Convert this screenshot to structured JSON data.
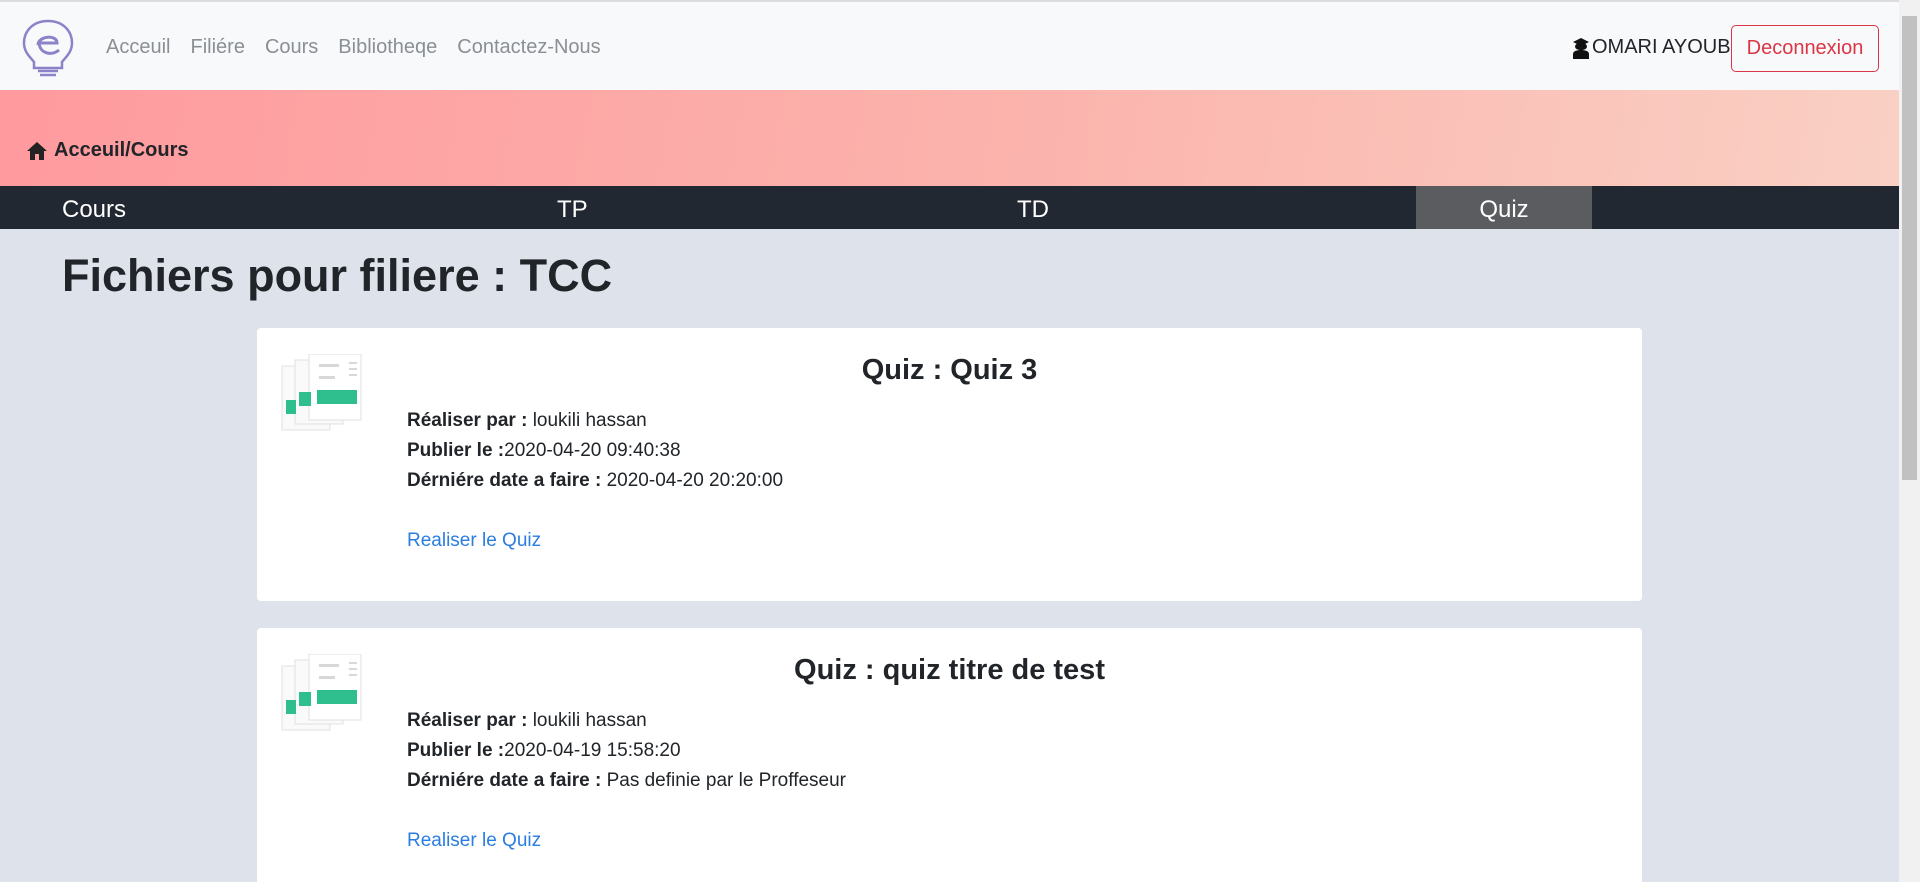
{
  "navbar": {
    "links": [
      "Acceuil",
      "Filiére",
      "Cours",
      "Bibliotheqe",
      "Contactez-Nous"
    ],
    "user_name": "OMARI AYOUB",
    "logout_label": "Deconnexion"
  },
  "banner": {
    "breadcrumb": "Acceuil/Cours"
  },
  "tabs": {
    "items": [
      "Cours",
      "TP",
      "TD",
      "Quiz"
    ],
    "active": "Quiz"
  },
  "main": {
    "title": "Fichiers pour filiere : TCC",
    "quizzes": [
      {
        "title": "Quiz : Quiz 3",
        "author_label": "Réaliser par :",
        "author": "loukili hassan",
        "published_label": "Publier le :",
        "published": "2020-04-20 09:40:38",
        "deadline_label": "Dérniére date a faire :",
        "deadline": "2020-04-20 20:20:00",
        "action_label": "Realiser le Quiz"
      },
      {
        "title": "Quiz : quiz titre de test",
        "author_label": "Réaliser par :",
        "author": "loukili hassan",
        "published_label": "Publier le :",
        "published": "2020-04-19 15:58:20",
        "deadline_label": "Dérniére date a faire :",
        "deadline": "Pas definie par le Proffeseur",
        "action_label": "Realiser le Quiz"
      }
    ]
  },
  "colors": {
    "accent_link": "#2a7de1",
    "danger": "#dc3545",
    "tabs_bg": "#222831",
    "active_tab_bg": "#5a5c60",
    "doc_accent": "#2fbf8f"
  }
}
